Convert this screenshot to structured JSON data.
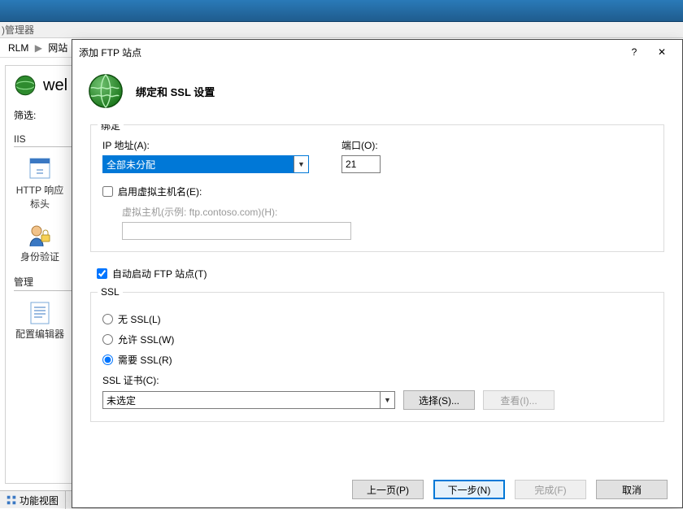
{
  "bg": {
    "app_label": ")管理器",
    "breadcrumb": {
      "seg1": "RLM",
      "seg2": "网站"
    },
    "site_title": "wel",
    "filter_label": "筛选:",
    "sections": {
      "iis": "IIS",
      "mgmt": "管理"
    },
    "icons": {
      "httpresp": "HTTP 响应标头",
      "auth": "身份验证",
      "cfged": "配置编辑器"
    },
    "status_tab": "功能视图"
  },
  "dialog": {
    "title": "添加 FTP 站点",
    "header_title": "绑定和 SSL 设置",
    "help_symbol": "?",
    "close_symbol": "✕",
    "binding": {
      "legend": "绑定",
      "ip_label": "IP 地址(A):",
      "ip_value": "全部未分配",
      "port_label": "端口(O):",
      "port_value": "21",
      "enable_vh_label": "启用虚拟主机名(E):",
      "vh_label": "虚拟主机(示例: ftp.contoso.com)(H):",
      "vh_value": ""
    },
    "auto_start_label": "自动启动 FTP 站点(T)",
    "ssl": {
      "legend": "SSL",
      "no_ssl": "无 SSL(L)",
      "allow_ssl": "允许 SSL(W)",
      "require_ssl": "需要 SSL(R)",
      "cert_label": "SSL 证书(C):",
      "cert_value": "未选定",
      "select_btn": "选择(S)...",
      "view_btn": "查看(I)..."
    },
    "footer": {
      "prev": "上一页(P)",
      "next": "下一步(N)",
      "finish": "完成(F)",
      "cancel": "取消"
    }
  }
}
